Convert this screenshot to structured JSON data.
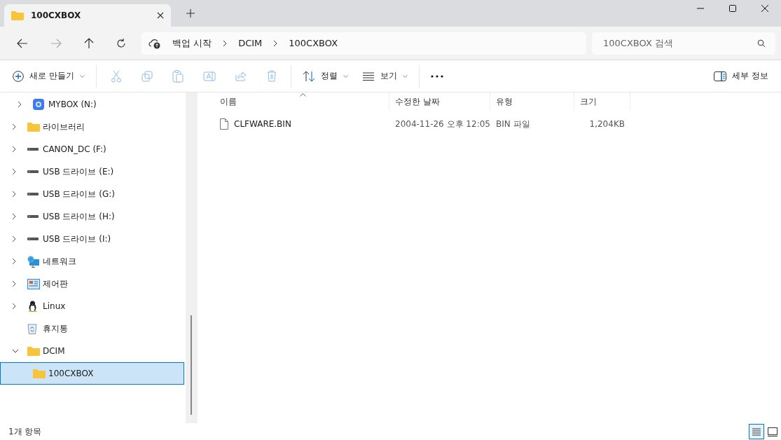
{
  "tabs": [
    {
      "title": "100CXBOX",
      "selected": true
    }
  ],
  "address": {
    "crumbs": [
      "백업 시작",
      "DCIM",
      "100CXBOX"
    ]
  },
  "search": {
    "placeholder": "100CXBOX 검색"
  },
  "toolbar": [
    {
      "kind": "new",
      "label": "새로 만들기"
    },
    {
      "kind": "cut",
      "disabled": true
    },
    {
      "kind": "copy",
      "disabled": true
    },
    {
      "kind": "paste",
      "disabled": true
    },
    {
      "kind": "rename",
      "disabled": true
    },
    {
      "kind": "share",
      "disabled": true
    },
    {
      "kind": "delete",
      "disabled": true
    },
    {
      "kind": "sort",
      "label": "정렬"
    },
    {
      "kind": "view",
      "label": "보기"
    },
    {
      "kind": "more"
    }
  ],
  "details_button": {
    "label": "세부 정보"
  },
  "nav_tree": [
    {
      "children": [
        {
          "label": "MYBOX (N:)",
          "kind": "cloud",
          "expanded": false,
          "selected": false
        }
      ]
    },
    {
      "label": "라이브러리",
      "kind": "folder",
      "expanded": false,
      "selected": false
    },
    {
      "label": "CANON_DC (F:)",
      "kind": "drive",
      "expanded": false,
      "selected": false
    },
    {
      "label": "USB 드라이브 (E:)",
      "kind": "drive",
      "expanded": false,
      "selected": false
    },
    {
      "label": "USB 드라이브 (G:)",
      "kind": "drive",
      "expanded": false,
      "selected": false
    },
    {
      "label": "USB 드라이브 (H:)",
      "kind": "drive",
      "expanded": false,
      "selected": false
    },
    {
      "label": "USB 드라이브 (I:)",
      "kind": "drive",
      "expanded": false,
      "selected": false
    },
    {
      "label": "네트워크",
      "kind": "network",
      "expanded": false,
      "selected": false
    },
    {
      "label": "제어판",
      "kind": "control",
      "expanded": false,
      "selected": false
    },
    {
      "label": "Linux",
      "kind": "linux",
      "expanded": false,
      "selected": false
    },
    {
      "label": "휴지통",
      "kind": "recycle",
      "selected": false
    },
    {
      "label": "DCIM",
      "kind": "folder",
      "expanded": true,
      "selected": false,
      "children": [
        {
          "label": "100CXBOX",
          "kind": "folder",
          "selected": true
        }
      ]
    }
  ],
  "table": {
    "columns": [
      "이름",
      "수정한 날짜",
      "유형",
      "크기"
    ],
    "rows": [
      [
        "CLFWARE.BIN",
        "2004-11-26 오후 12:05",
        "BIN 파일",
        "1,204KB"
      ]
    ]
  },
  "status_bar": {
    "count": "1개 항목"
  }
}
